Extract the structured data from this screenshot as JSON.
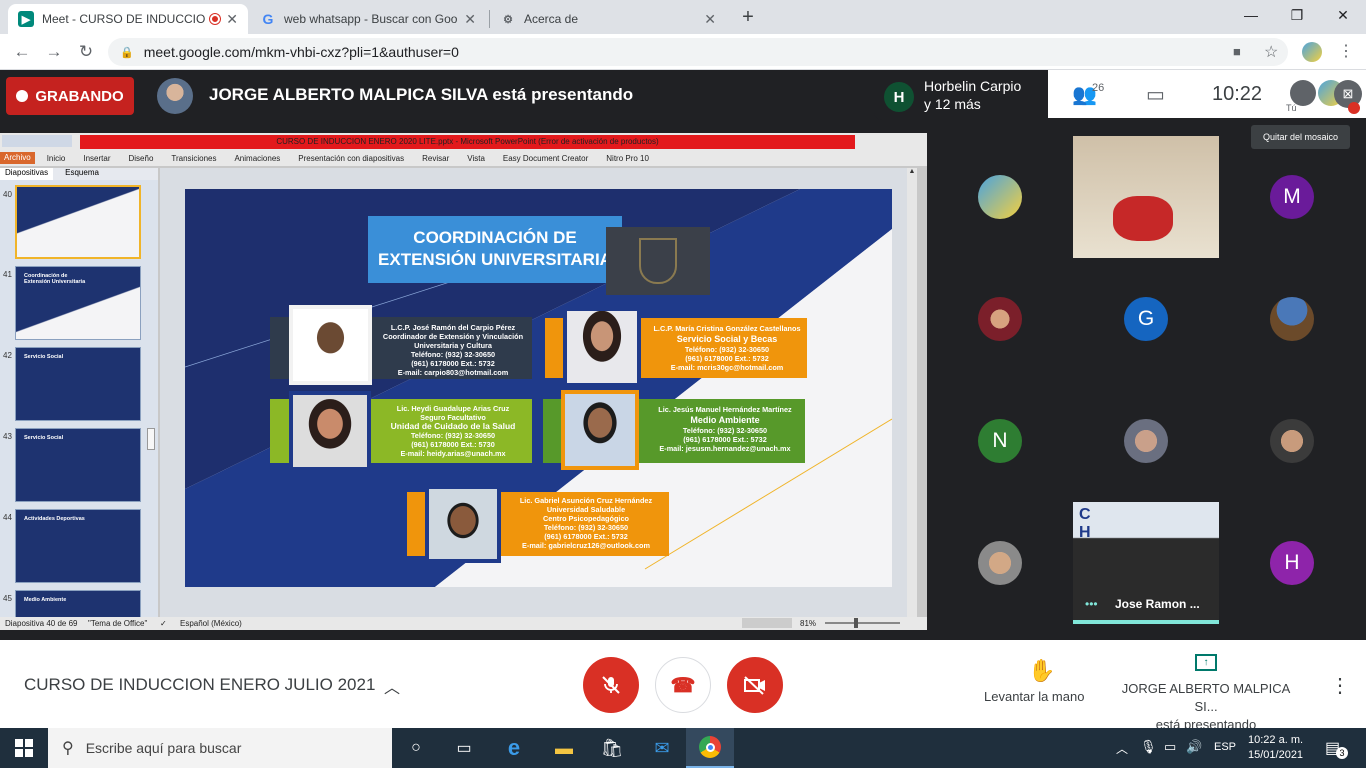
{
  "browser": {
    "tabs": [
      {
        "title": "Meet - CURSO DE INDUCCIO",
        "favicon": "meet-icon"
      },
      {
        "title": "web whatsapp - Buscar con Goo",
        "favicon": "google-icon"
      },
      {
        "title": "Acerca de",
        "favicon": "settings-icon"
      }
    ],
    "url": "meet.google.com/mkm-vhbi-cxz?pli=1&authuser=0"
  },
  "meet": {
    "recording_label": "GRABANDO",
    "presenting_text": "JORGE ALBERTO MALPICA SILVA está presentando",
    "participants_line1": "Horbelin Carpio",
    "participants_line2": "y 12 más",
    "participant_initial": "H",
    "people_count": "26",
    "clock": "10:22",
    "you_label": "Tú",
    "tooltip": "Quitar del mosaico",
    "meeting_name": "CURSO DE INDUCCION ENERO JULIO 2021",
    "raise_hand": "Levantar la mano",
    "presenting_name": "JORGE ALBERTO MALPICA SI...",
    "presenting_sub": "está presentando",
    "tile_name_jose": "Jose Ramon ...",
    "tiles": [
      {
        "initial": "M",
        "color": "#6a1b9a"
      },
      {
        "initial": "G",
        "color": "#1565c0"
      },
      {
        "initial": "N",
        "color": "#2e7d32"
      },
      {
        "initial": "H",
        "color": "#8e24aa"
      }
    ]
  },
  "powerpoint": {
    "title": "CURSO DE INDUCCION ENERO 2020 LITE.pptx - Microsoft PowerPoint (Error de activación de productos)",
    "menu": [
      "Archivo",
      "Inicio",
      "Insertar",
      "Diseño",
      "Transiciones",
      "Animaciones",
      "Presentación con diapositivas",
      "Revisar",
      "Vista",
      "Easy Document Creator",
      "Nitro Pro 10"
    ],
    "panel_tabs": [
      "Diapositivas",
      "Esquema"
    ],
    "thumbs": [
      {
        "num": "40",
        "title": ""
      },
      {
        "num": "41",
        "title": "Coordinación de Extensión Universitaria"
      },
      {
        "num": "42",
        "title": "Servicio Social"
      },
      {
        "num": "43",
        "title": "Servicio Social"
      },
      {
        "num": "44",
        "title": "Actividades Deportivas"
      },
      {
        "num": "45",
        "title": "Medio Ambiente"
      }
    ],
    "status_slide": "Diapositiva 40 de 69",
    "status_theme": "\"Tema de Office\"",
    "status_lang": "Español (México)",
    "zoom": "81%"
  },
  "slide": {
    "heading": "COORDINACIÓN DE EXTENSIÓN UNIVERSITARIA",
    "cards": [
      {
        "name": "L.C.P. José Ramón del Carpio Pérez",
        "role": "Coordinador de Extensión y Vinculación Universitaria y Cultura",
        "phone": "Teléfono: (932) 32-30650",
        "ext": "(961) 6178000 Ext.: 5732",
        "email": "E-mail: carpio803@hotmail.com"
      },
      {
        "name": "L.C.P. María Cristina González Castellanos",
        "role": "Servicio Social y Becas",
        "phone": "Teléfono: (932) 32-30650",
        "ext": "(961) 6178000 Ext.: 5732",
        "email": "E-mail: mcris30gc@hotmail.com"
      },
      {
        "name": "Lic. Heydi Guadalupe Arias Cruz",
        "role": "Seguro Facultativo",
        "role2": "Unidad de Cuidado de la Salud",
        "phone": "Teléfono: (932) 32-30650",
        "ext": "(961) 6178000 Ext.: 5730",
        "email": "E-mail: heidy.arias@unach.mx"
      },
      {
        "name": "Lic. Jesús Manuel Hernández Martínez",
        "role": "Medio Ambiente",
        "phone": "Teléfono: (932) 32-30650",
        "ext": "(961) 6178000 Ext.: 5732",
        "email": "E-mail: jesusm.hernandez@unach.mx"
      },
      {
        "name": "Lic. Gabriel Asunción Cruz Hernández",
        "role": "Universidad Saludable",
        "role2": "Centro Psicopedagógico",
        "phone": "Teléfono: (932) 32-30650",
        "ext": "(961) 6178000 Ext.: 5732",
        "email": "E-mail: gabrielcruz126@outlook.com"
      }
    ]
  },
  "taskbar": {
    "search_placeholder": "Escribe aquí para buscar",
    "lang": "ESP",
    "time": "10:22 a. m.",
    "date": "15/01/2021",
    "notifications": "3"
  }
}
